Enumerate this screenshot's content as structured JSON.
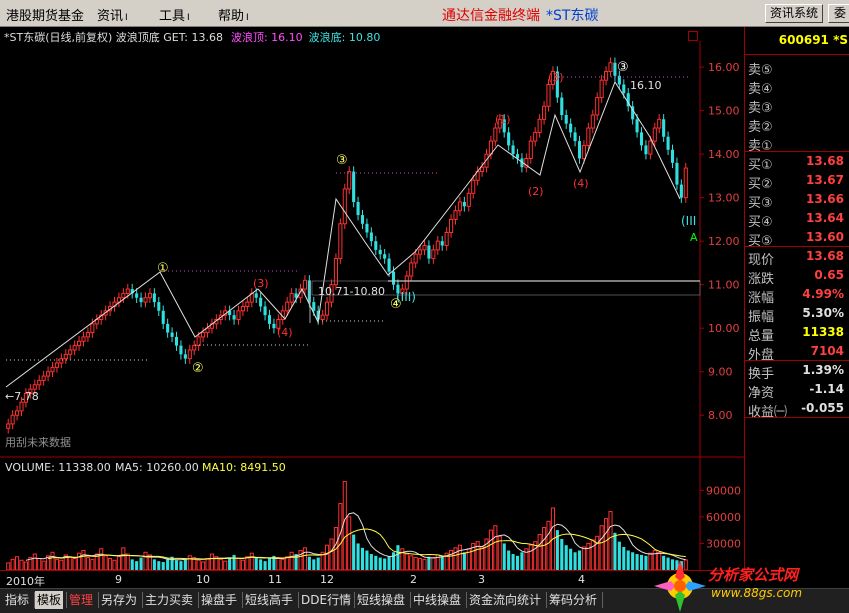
{
  "menu": [
    {
      "label": "港股期货基金",
      "arrow": ""
    },
    {
      "label": "资讯",
      "arrow": "Ⅰ"
    },
    {
      "label": "工具",
      "arrow": "Ⅰ"
    },
    {
      "label": "帮助",
      "arrow": "Ⅰ"
    }
  ],
  "window_title": {
    "app": "通达信金融终端",
    "stock": "*ST东碳"
  },
  "system_button": "资讯系统",
  "system_button2": "委",
  "chart_header": {
    "name": "*ST东碳(日线,前复权) 波浪顶底 GET: 13.68",
    "wave_top": "波浪顶: 16.10",
    "wave_bottom": "波浪底: 10.80"
  },
  "volume_header": {
    "volume": "VOLUME: 11338.00",
    "ma5": "MA5: 10260.00",
    "ma10": "MA10: 8491.50"
  },
  "price_axis": [
    "16.00",
    "15.00",
    "14.00",
    "13.00",
    "12.00",
    "11.00",
    "10.00",
    "9.00",
    "8.00"
  ],
  "volume_axis": [
    "90000",
    "60000",
    "30000"
  ],
  "annotations": {
    "low_price": "←7.78",
    "high_price": "16.10",
    "range_label": "10.71-10.80",
    "wave_III": "(III)",
    "wave_III_right": "(III",
    "a_label": "A",
    "future_data": "用刮未来数据"
  },
  "wave_labels": {
    "circle_1": "①",
    "circle_2": "②",
    "circle_3": "③",
    "circle_4": "④",
    "paren_1": "(1)",
    "paren_2": "(2)",
    "paren_3": "(3)",
    "paren_4": "(4)"
  },
  "date_axis": [
    "2010年",
    "9",
    "10",
    "11",
    "12",
    "2",
    "3",
    "4"
  ],
  "stock_code": "600691 *S",
  "quote_rows": [
    {
      "label": "卖⑤",
      "value": "",
      "color": "#ffffff"
    },
    {
      "label": "卖④",
      "value": "",
      "color": "#ffffff"
    },
    {
      "label": "卖③",
      "value": "",
      "color": "#ffffff"
    },
    {
      "label": "卖②",
      "value": "",
      "color": "#ffffff"
    },
    {
      "label": "卖①",
      "value": "",
      "color": "#ffffff"
    },
    {
      "label": "买①",
      "value": "13.68",
      "color": "#ff4040"
    },
    {
      "label": "买②",
      "value": "13.67",
      "color": "#ff4040"
    },
    {
      "label": "买③",
      "value": "13.66",
      "color": "#ff4040"
    },
    {
      "label": "买④",
      "value": "13.64",
      "color": "#ff4040"
    },
    {
      "label": "买⑤",
      "value": "13.60",
      "color": "#ff4040"
    }
  ],
  "stats_rows": [
    {
      "label": "现价",
      "value": "13.68",
      "color": "#ff4040"
    },
    {
      "label": "涨跌",
      "value": "0.65",
      "color": "#ff4040"
    },
    {
      "label": "涨幅",
      "value": "4.99%",
      "color": "#ff4040"
    },
    {
      "label": "振幅",
      "value": "5.30%",
      "color": "#e0e0e0"
    },
    {
      "label": "总量",
      "value": "11338",
      "color": "#ffff00"
    },
    {
      "label": "外盘",
      "value": "7104",
      "color": "#ff4040"
    }
  ],
  "fund_rows": [
    {
      "label": "换手",
      "value": "1.39%",
      "color": "#e0e0e0"
    },
    {
      "label": "净资",
      "value": "-1.14",
      "color": "#e0e0e0"
    },
    {
      "label": "收益㈠",
      "value": "-0.055",
      "color": "#e0e0e0"
    }
  ],
  "tabs": [
    {
      "label": "指标",
      "state": ""
    },
    {
      "label": "模板",
      "state": "active"
    },
    {
      "label": "管理",
      "state": "sel"
    },
    {
      "label": "另存为",
      "state": ""
    },
    {
      "label": "主力买卖",
      "state": ""
    },
    {
      "label": "操盘手",
      "state": ""
    },
    {
      "label": "短线高手",
      "state": ""
    },
    {
      "label": "DDE行情",
      "state": ""
    },
    {
      "label": "短线操盘",
      "state": ""
    },
    {
      "label": "中线操盘",
      "state": ""
    },
    {
      "label": "资金流向统计",
      "state": ""
    },
    {
      "label": "筹码分析",
      "state": ""
    }
  ],
  "watermark": {
    "brand": "分析家公式网",
    "url": "www.88gs.com"
  },
  "chart_data": {
    "type": "candlestick",
    "price_range": [
      7.5,
      16.6
    ],
    "volume_range": [
      0,
      105000
    ],
    "closes": [
      7.8,
      8.0,
      8.1,
      8.3,
      8.5,
      8.6,
      8.7,
      8.8,
      8.9,
      9.0,
      9.1,
      9.2,
      9.3,
      9.4,
      9.5,
      9.6,
      9.7,
      9.8,
      9.9,
      10.1,
      10.2,
      10.3,
      10.4,
      10.5,
      10.6,
      10.7,
      10.8,
      10.9,
      10.8,
      10.7,
      10.6,
      10.7,
      10.8,
      10.6,
      10.4,
      10.1,
      9.9,
      9.8,
      9.6,
      9.4,
      9.3,
      9.5,
      9.6,
      9.8,
      9.9,
      10.0,
      10.1,
      10.2,
      10.3,
      10.4,
      10.3,
      10.2,
      10.4,
      10.5,
      10.6,
      10.8,
      10.7,
      10.5,
      10.3,
      10.1,
      10.0,
      10.2,
      10.4,
      10.6,
      10.8,
      10.7,
      10.9,
      11.1,
      10.6,
      10.4,
      10.2,
      10.3,
      10.6,
      11.0,
      11.6,
      12.4,
      13.2,
      13.6,
      12.9,
      12.6,
      12.4,
      12.2,
      12.0,
      11.8,
      11.7,
      11.6,
      11.3,
      11.0,
      10.8,
      10.9,
      11.2,
      11.5,
      11.7,
      11.8,
      11.9,
      11.6,
      11.8,
      12.0,
      11.9,
      12.2,
      12.5,
      12.7,
      12.9,
      12.8,
      13.1,
      13.4,
      13.6,
      13.7,
      14.0,
      14.3,
      14.6,
      14.8,
      14.5,
      14.2,
      14.0,
      13.9,
      13.7,
      13.9,
      14.3,
      14.5,
      14.8,
      15.1,
      15.6,
      15.9,
      15.3,
      14.9,
      14.7,
      14.5,
      14.3,
      13.9,
      14.2,
      14.6,
      14.9,
      15.3,
      15.7,
      15.9,
      16.1,
      15.8,
      15.6,
      15.4,
      15.1,
      14.8,
      14.5,
      14.2,
      14.0,
      14.3,
      14.6,
      14.8,
      14.4,
      14.1,
      13.8,
      13.3,
      13.0,
      13.68
    ],
    "volumes": [
      8000,
      12000,
      15000,
      11000,
      9000,
      14000,
      18000,
      13000,
      10000,
      16000,
      20000,
      12000,
      11000,
      17000,
      15000,
      13000,
      19000,
      22000,
      14000,
      12000,
      18000,
      24000,
      16000,
      13000,
      11000,
      15000,
      25000,
      18000,
      12000,
      10000,
      14000,
      20000,
      17000,
      12000,
      10000,
      9000,
      13000,
      15000,
      11000,
      10000,
      12000,
      16000,
      14000,
      11000,
      9000,
      13000,
      18000,
      15000,
      12000,
      10000,
      14000,
      17000,
      13000,
      11000,
      15000,
      19000,
      14000,
      12000,
      10000,
      13000,
      16000,
      14000,
      12000,
      15000,
      20000,
      18000,
      22000,
      25000,
      15000,
      12000,
      14000,
      20000,
      28000,
      35000,
      48000,
      75000,
      100000,
      60000,
      40000,
      30000,
      25000,
      22000,
      18000,
      16000,
      14000,
      13000,
      15000,
      20000,
      28000,
      24000,
      18000,
      16000,
      14000,
      13000,
      12000,
      15000,
      14000,
      17000,
      16000,
      19000,
      22000,
      25000,
      28000,
      20000,
      24000,
      30000,
      32000,
      26000,
      35000,
      45000,
      50000,
      38000,
      30000,
      22000,
      18000,
      16000,
      20000,
      24000,
      28000,
      32000,
      40000,
      48000,
      55000,
      70000,
      45000,
      35000,
      28000,
      24000,
      20000,
      22000,
      26000,
      30000,
      34000,
      38000,
      50000,
      58000,
      66000,
      42000,
      32000,
      26000,
      22000,
      20000,
      18000,
      17000,
      16000,
      19000,
      22000,
      20000,
      16000,
      14000,
      12000,
      11000,
      10000,
      11338
    ],
    "ma5": 10260,
    "ma10": 8491.5
  }
}
